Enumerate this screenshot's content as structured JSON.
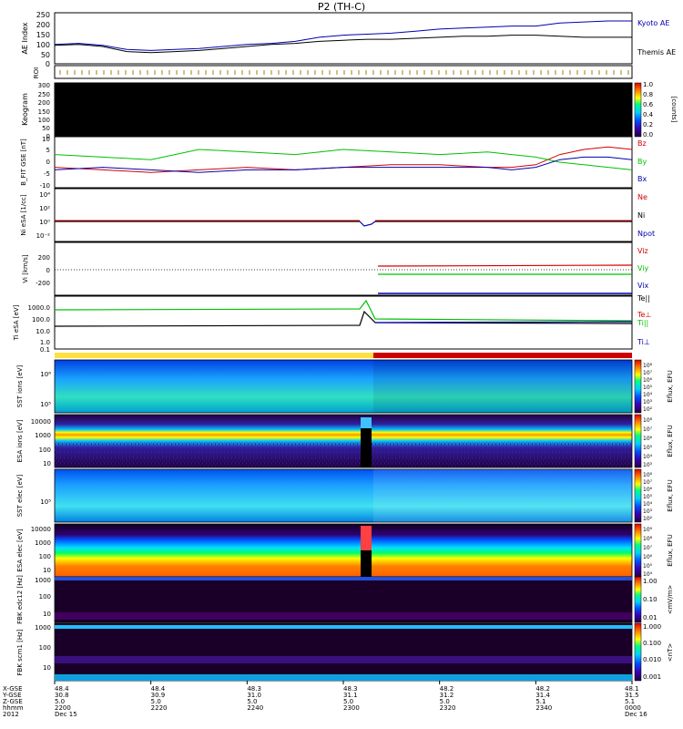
{
  "title": "P2 (TH-C)",
  "colors": {
    "red": "#d40000",
    "green": "#00c000",
    "blue": "#0000b0",
    "black": "#000000",
    "yellow": "#ffe040",
    "themis_red": "#d00000"
  },
  "chart_data": [
    {
      "type": "line",
      "ylabel": "AE Index",
      "yticks": [
        "250",
        "200",
        "150",
        "100",
        "50",
        "0"
      ],
      "ylim": [
        0,
        250
      ],
      "series": [
        {
          "name": "Kyoto AE",
          "color": "#0000b0",
          "x": [
            0,
            5,
            10,
            15,
            20,
            25,
            30,
            35,
            40,
            45,
            50,
            55,
            60,
            65,
            70,
            75,
            80,
            85,
            90,
            95,
            100,
            105,
            110,
            115,
            120
          ],
          "y": [
            95,
            100,
            90,
            70,
            65,
            70,
            75,
            85,
            95,
            100,
            110,
            130,
            140,
            145,
            150,
            160,
            170,
            175,
            180,
            185,
            185,
            200,
            205,
            210,
            210
          ]
        },
        {
          "name": "Themis AE",
          "color": "#000000",
          "x": [
            0,
            5,
            10,
            15,
            20,
            25,
            30,
            35,
            40,
            45,
            50,
            55,
            60,
            65,
            70,
            75,
            80,
            85,
            90,
            95,
            100,
            105,
            110,
            115,
            120
          ],
          "y": [
            90,
            95,
            85,
            60,
            55,
            60,
            65,
            75,
            85,
            95,
            100,
            110,
            115,
            120,
            120,
            125,
            130,
            135,
            135,
            140,
            140,
            135,
            130,
            130,
            130
          ]
        }
      ]
    },
    {
      "type": "table",
      "ylabel": "ROI"
    },
    {
      "type": "heatmap",
      "ylabel": "Keogram",
      "yticks": [
        "300",
        "250",
        "200",
        "150",
        "100",
        "50",
        "0"
      ],
      "colorbar": {
        "ticks": [
          "1.0",
          "0.8",
          "0.6",
          "0.4",
          "0.2",
          "0.0"
        ],
        "label": "[counts]"
      }
    },
    {
      "type": "line",
      "ylabel": "B_FIT GSE [nT]",
      "yticks": [
        "10",
        "5",
        "0",
        "-5",
        "-10"
      ],
      "ylim": [
        -10,
        10
      ],
      "series": [
        {
          "name": "Bz",
          "color": "#d40000",
          "x": [
            0,
            10,
            20,
            30,
            40,
            50,
            60,
            70,
            80,
            90,
            95,
            100,
            105,
            110,
            115,
            120
          ],
          "y": [
            -2,
            -3,
            -4,
            -3,
            -2,
            -3,
            -2,
            -1,
            -1,
            -2,
            -2,
            -1,
            3,
            5,
            6,
            5
          ]
        },
        {
          "name": "By",
          "color": "#00c000",
          "x": [
            0,
            10,
            20,
            30,
            40,
            50,
            60,
            70,
            80,
            90,
            95,
            100,
            105,
            110,
            115,
            120
          ],
          "y": [
            3,
            2,
            1,
            5,
            4,
            3,
            5,
            4,
            3,
            4,
            3,
            2,
            0,
            -1,
            -2,
            -3
          ]
        },
        {
          "name": "Bx",
          "color": "#0000b0",
          "x": [
            0,
            10,
            20,
            30,
            40,
            50,
            60,
            70,
            80,
            90,
            95,
            100,
            105,
            110,
            115,
            120
          ],
          "y": [
            -3,
            -2,
            -3,
            -4,
            -3,
            -3,
            -2,
            -2,
            -2,
            -2,
            -3,
            -2,
            1,
            2,
            2,
            1
          ]
        }
      ]
    },
    {
      "type": "line",
      "ylabel": "Ni eSA [1/cc]",
      "yticks": [
        "10⁴",
        "10²",
        "10⁰",
        "10⁻²"
      ],
      "series": [
        {
          "name": "Ne",
          "color": "#d40000"
        },
        {
          "name": "Ni",
          "color": "#000000"
        },
        {
          "name": "Npot",
          "color": "#0000b0"
        }
      ]
    },
    {
      "type": "line",
      "ylabel": "Vi [km/s]",
      "yticks": [
        "200",
        "0",
        "-200"
      ],
      "ylim": [
        -300,
        300
      ],
      "series": [
        {
          "name": "Viz",
          "color": "#d40000"
        },
        {
          "name": "Viy",
          "color": "#00c000"
        },
        {
          "name": "Vix",
          "color": "#0000b0"
        }
      ]
    },
    {
      "type": "line",
      "ylabel": "Ti eSA [eV]",
      "yticks": [
        "1000.0",
        "100.0",
        "10.0",
        "1.0",
        "0.1"
      ],
      "series": [
        {
          "name": "Te||",
          "color": "#000000"
        },
        {
          "name": "Te⊥",
          "color": "#d40000"
        },
        {
          "name": "Ti||",
          "color": "#00c000"
        },
        {
          "name": "Ti⊥",
          "color": "#0000b0"
        }
      ]
    },
    {
      "type": "heatmap",
      "ylabel": "SST ions [eV]",
      "yticks": [
        "10⁶",
        "10⁵"
      ],
      "cbar_label": "Eflux, EFU",
      "cbar_ticks": [
        "10⁸",
        "10⁷",
        "10⁶",
        "10⁵",
        "10⁴",
        "10³",
        "10²"
      ]
    },
    {
      "type": "heatmap",
      "ylabel": "ESA ions [eV]",
      "yticks": [
        "10000",
        "1000",
        "100",
        "10"
      ],
      "cbar_label": "Eflux, EFU",
      "cbar_ticks": [
        "10⁸",
        "10⁷",
        "10⁶",
        "10⁵",
        "10⁴",
        "10³"
      ]
    },
    {
      "type": "heatmap",
      "ylabel": "SST elec [eV]",
      "yticks": [
        "10⁵"
      ],
      "cbar_label": "Eflux, EFU",
      "cbar_ticks": [
        "10⁸",
        "10⁷",
        "10⁶",
        "10⁵",
        "10⁴",
        "10³",
        "10²"
      ]
    },
    {
      "type": "heatmap",
      "ylabel": "ESA elec [eV]",
      "yticks": [
        "10000",
        "1000",
        "100",
        "10"
      ],
      "cbar_label": "Eflux, EFU",
      "cbar_ticks": [
        "10⁹",
        "10⁸",
        "10⁷",
        "10⁶",
        "10⁵",
        "10⁴"
      ]
    },
    {
      "type": "heatmap",
      "ylabel": "FBK edc12 [Hz]",
      "yticks": [
        "1000",
        "100",
        "10"
      ],
      "cbar_label": "<mV/m>",
      "cbar_ticks": [
        "1.00",
        "0.10",
        "0.01"
      ]
    },
    {
      "type": "heatmap",
      "ylabel": "FBK scm1 [Hz]",
      "yticks": [
        "1000",
        "100",
        "10"
      ],
      "cbar_label": "<nT>",
      "cbar_ticks": [
        "1.000",
        "0.100",
        "0.010",
        "0.001"
      ]
    }
  ],
  "ephemeris": {
    "row_labels": [
      "X-GSE",
      "Y-GSE",
      "Z-GSE",
      "hhmm",
      "2012"
    ],
    "columns": [
      {
        "x": "48.4",
        "y": "30.8",
        "z": "5.0",
        "hhmm": "2200",
        "date": "Dec 15"
      },
      {
        "x": "48.4",
        "y": "30.9",
        "z": "5.0",
        "hhmm": "2220",
        "date": ""
      },
      {
        "x": "48.3",
        "y": "31.0",
        "z": "5.0",
        "hhmm": "2240",
        "date": ""
      },
      {
        "x": "48.3",
        "y": "31.1",
        "z": "5.0",
        "hhmm": "2300",
        "date": ""
      },
      {
        "x": "48.2",
        "y": "31.2",
        "z": "5.0",
        "hhmm": "2320",
        "date": ""
      },
      {
        "x": "48.2",
        "y": "31.4",
        "z": "5.1",
        "hhmm": "2340",
        "date": ""
      },
      {
        "x": "48.1",
        "y": "31.5",
        "z": "5.1",
        "hhmm": "0000",
        "date": "Dec 16"
      }
    ]
  }
}
